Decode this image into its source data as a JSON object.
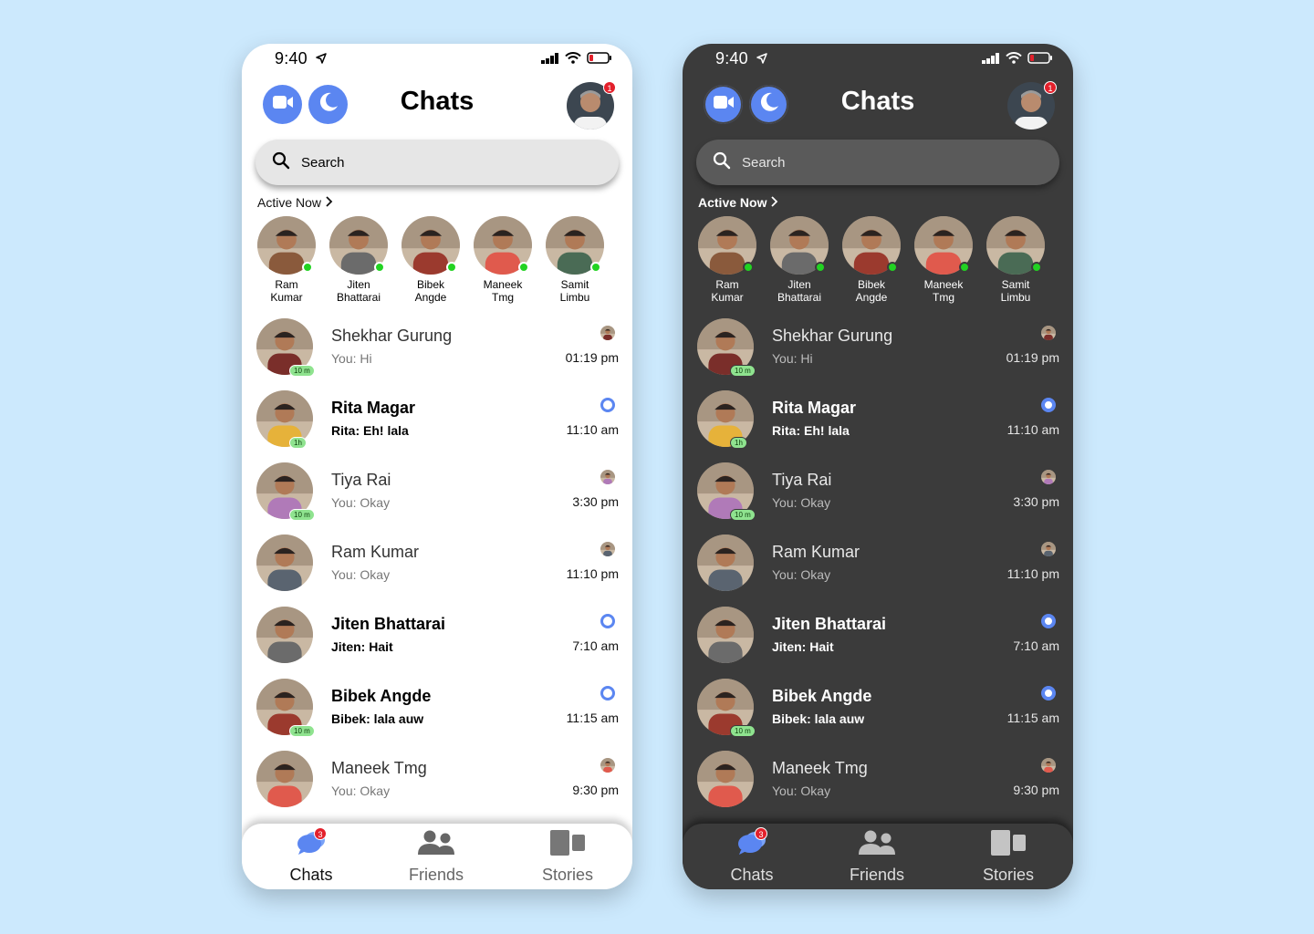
{
  "status": {
    "time": "9:40"
  },
  "header": {
    "title": "Chats",
    "notification_count": "1"
  },
  "search": {
    "placeholder": "Search"
  },
  "active_now": {
    "label": "Active Now",
    "people": [
      {
        "first": "Ram",
        "last": "Kumar",
        "hue": "#8a5a3c"
      },
      {
        "first": "Jiten",
        "last": "Bhattarai",
        "hue": "#6b6b6b"
      },
      {
        "first": "Bibek",
        "last": "Angde",
        "hue": "#9b3a2e"
      },
      {
        "first": "Maneek",
        "last": "Tmg",
        "hue": "#e05a4d"
      },
      {
        "first": "Samit",
        "last": "Limbu",
        "hue": "#4a6b55"
      }
    ]
  },
  "chats": [
    {
      "name": "Shekhar Gurung",
      "message": "You: Hi",
      "time": "01:19 pm",
      "unread": false,
      "active_badge": "10 m",
      "hue": "#7a2e2a"
    },
    {
      "name": "Rita Magar",
      "message": "Rita: Eh! lala",
      "time": "11:10 am",
      "unread": true,
      "active_badge": "1h",
      "hue": "#e6b23a"
    },
    {
      "name": "Tiya Rai",
      "message": "You: Okay",
      "time": "3:30 pm",
      "unread": false,
      "active_badge": "10 m",
      "hue": "#b07ab8"
    },
    {
      "name": "Ram Kumar",
      "message": "You: Okay",
      "time": "11:10 pm",
      "unread": false,
      "active_badge": "",
      "hue": "#5a6470"
    },
    {
      "name": "Jiten Bhattarai",
      "message": "Jiten: Hait",
      "time": "7:10 am",
      "unread": true,
      "active_badge": "",
      "hue": "#6b6b6b"
    },
    {
      "name": "Bibek Angde",
      "message": "Bibek: lala auw",
      "time": "11:15 am",
      "unread": true,
      "active_badge": "10 m",
      "hue": "#9b3a2e"
    },
    {
      "name": "Maneek Tmg",
      "message": "You: Okay",
      "time": "9:30 pm",
      "unread": false,
      "active_badge": "",
      "hue": "#e05a4d"
    }
  ],
  "tabs": [
    {
      "label": "Chats",
      "badge": "3",
      "icon": "chat-bubbles-icon"
    },
    {
      "label": "Friends",
      "badge": "",
      "icon": "friends-icon"
    },
    {
      "label": "Stories",
      "badge": "",
      "icon": "stories-icon"
    }
  ],
  "colors": {
    "accent": "#5b86f1",
    "online": "#22d322",
    "badge": "#e3202b",
    "background": "#cce9fd",
    "dark_surface": "#3b3b3b"
  }
}
